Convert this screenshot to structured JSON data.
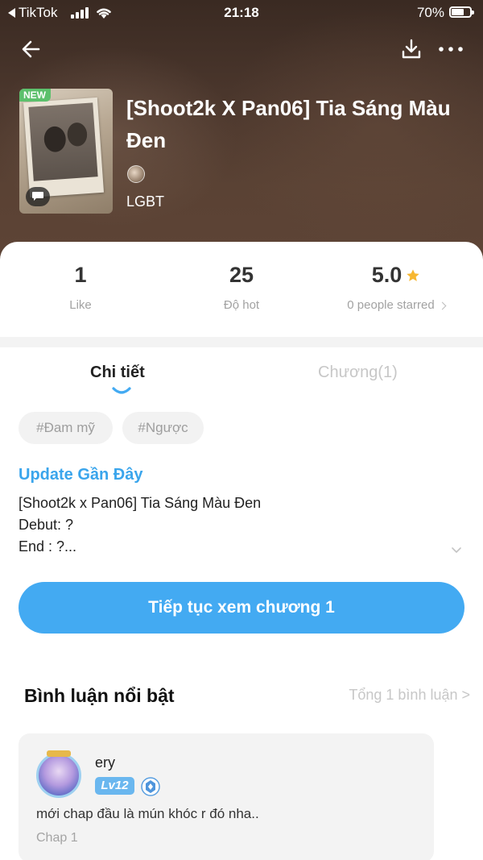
{
  "status_bar": {
    "app": "TikTok",
    "time": "21:18",
    "battery": "70%",
    "battery_level": 0.7
  },
  "header": {
    "back_icon": "arrow-left-icon",
    "download_icon": "download-icon",
    "more_icon": "more-dots-icon"
  },
  "book": {
    "badge": "NEW",
    "title": "[Shoot2k X Pan06] Tia Sáng Màu Đen",
    "genre": "LGBT"
  },
  "stats": {
    "likes": "1",
    "likes_label": "Like",
    "hot": "25",
    "hot_label": "Độ hot",
    "rating": "5.0",
    "rating_label": "0 people starred"
  },
  "tabs": [
    {
      "label": "Chi tiết",
      "active": true
    },
    {
      "label": "Chương(1)",
      "active": false
    }
  ],
  "tags": [
    "#Đam mỹ",
    "#Ngược"
  ],
  "description": {
    "heading": "Update Gần Đây",
    "lines": [
      "[Shoot2k x Pan06] Tia Sáng Màu Đen",
      "Debut: ?",
      "End : ?..."
    ]
  },
  "cta": {
    "label": "Tiếp tục xem chương 1"
  },
  "comments": {
    "title": "Bình luận nổi bật",
    "total": "Tổng 1 bình luận >",
    "items": [
      {
        "user": "ery",
        "level": "Lv12",
        "text": "mới chap đầu là mún khóc r đó nha..",
        "chapter": "Chap 1"
      }
    ]
  },
  "colors": {
    "accent": "#43aaf2",
    "link": "#3aa5ec",
    "star": "#f7b731",
    "new_badge": "#5cc06c"
  }
}
